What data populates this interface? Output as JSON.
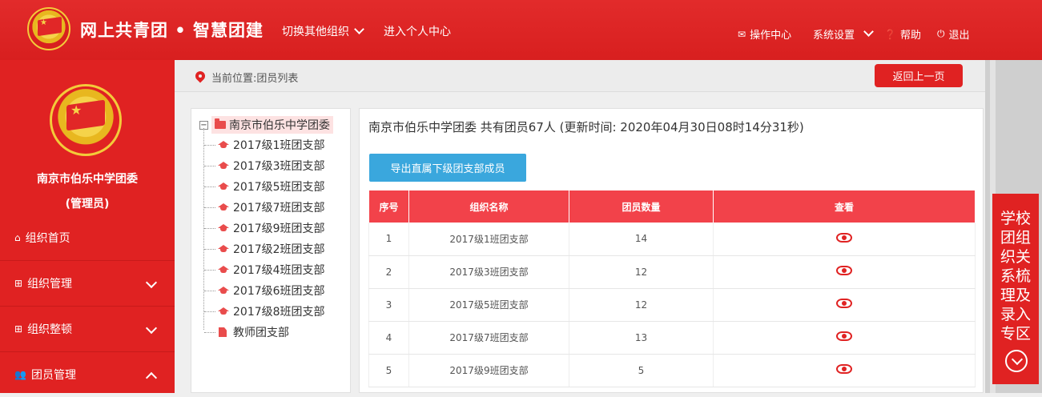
{
  "header": {
    "title": "网上共青团 • 智慧团建",
    "switch_org": "切换其他组织",
    "personal_center": "进入个人中心",
    "ops_center": "操作中心",
    "settings": "系统设置",
    "help": "帮助",
    "logout": "退出"
  },
  "sidebar": {
    "org_name": "南京市伯乐中学团委",
    "role": "(管理员)",
    "menu": [
      {
        "label": "组织首页",
        "icon": "home-icon"
      },
      {
        "label": "组织管理",
        "icon": "org-chart-icon"
      },
      {
        "label": "组织整顿",
        "icon": "org-chart-icon"
      },
      {
        "label": "团员管理",
        "icon": "users-icon"
      }
    ]
  },
  "breadcrumb": {
    "text": "当前位置:团员列表",
    "back": "返回上一页"
  },
  "tree": {
    "root": "南京市伯乐中学团委",
    "nodes": [
      "2017级1班团支部",
      "2017级3班团支部",
      "2017级5班团支部",
      "2017级7班团支部",
      "2017级9班团支部",
      "2017级2班团支部",
      "2017级4班团支部",
      "2017级6班团支部",
      "2017级8班团支部"
    ],
    "teacher_node": "教师团支部"
  },
  "content": {
    "summary": "南京市伯乐中学团委 共有团员67人 (更新时间: 2020年04月30日08时14分31秒)",
    "export_button": "导出直属下级团支部成员",
    "columns": [
      "序号",
      "组织名称",
      "团员数量",
      "查看"
    ],
    "rows": [
      {
        "no": "1",
        "name": "2017级1班团支部",
        "count": "14"
      },
      {
        "no": "2",
        "name": "2017级3班团支部",
        "count": "12"
      },
      {
        "no": "3",
        "name": "2017级5班团支部",
        "count": "12"
      },
      {
        "no": "4",
        "name": "2017级7班团支部",
        "count": "13"
      },
      {
        "no": "5",
        "name": "2017级9班团支部",
        "count": "5"
      }
    ]
  },
  "promo": {
    "text": "学校团组织关系梳理及录入专区"
  },
  "colors": {
    "brand_red": "#e02222",
    "header_red": "#f2424a",
    "export_blue": "#3aa7dd"
  }
}
